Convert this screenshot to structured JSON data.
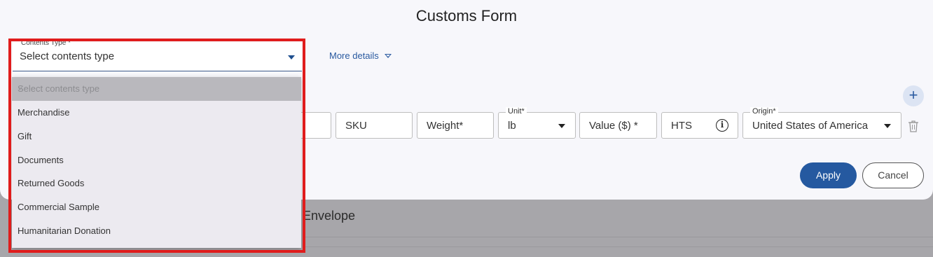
{
  "background": {
    "envelope_label": "Envelope"
  },
  "modal": {
    "title": "Customs Form",
    "contents_type": {
      "label": "Contents Type *",
      "value": "Select contents type"
    },
    "more_details_label": "More details",
    "add_item_label": "+",
    "item_row": {
      "sku_placeholder": "SKU",
      "weight_placeholder": "Weight*",
      "unit_label": "Unit*",
      "unit_value": "lb",
      "value_placeholder": "Value ($) *",
      "hts_placeholder": "HTS",
      "origin_label": "Origin*",
      "origin_value": "United States of America"
    },
    "apply_label": "Apply",
    "cancel_label": "Cancel"
  },
  "dropdown": {
    "options": [
      {
        "label": "Select contents type",
        "selected": true
      },
      {
        "label": "Merchandise"
      },
      {
        "label": "Gift"
      },
      {
        "label": "Documents"
      },
      {
        "label": "Returned Goods"
      },
      {
        "label": "Commercial Sample"
      },
      {
        "label": "Humanitarian Donation"
      }
    ]
  },
  "colors": {
    "primary": "#2559a0",
    "highlight": "#e01c1c"
  }
}
